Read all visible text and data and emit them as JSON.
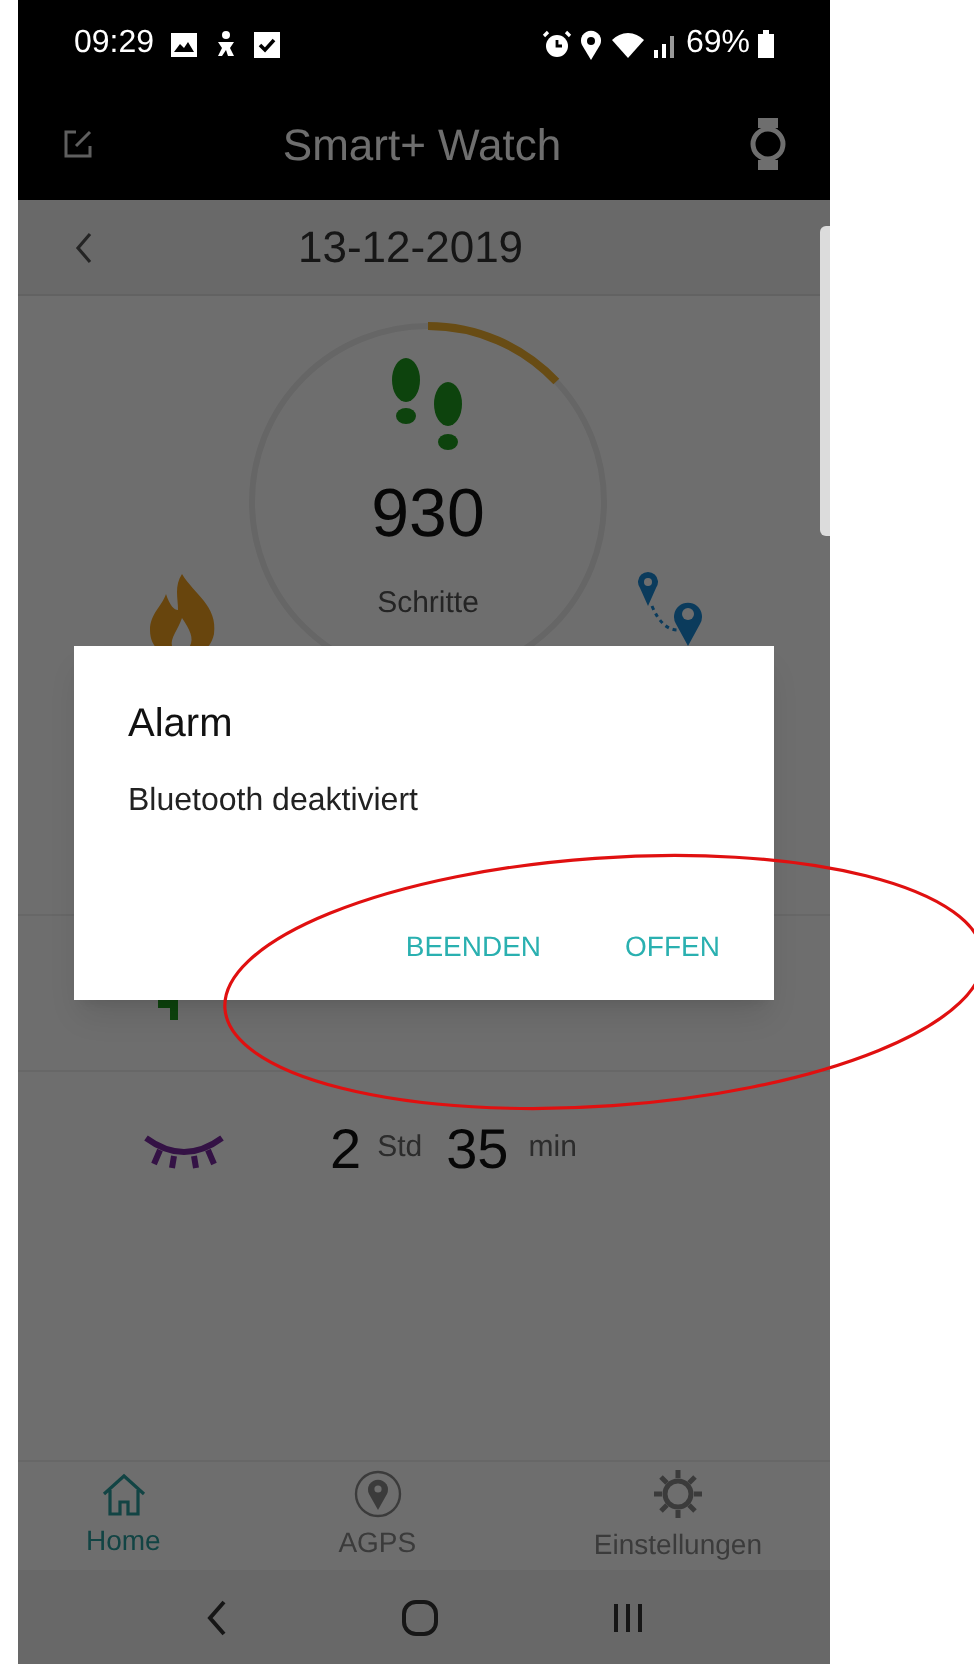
{
  "status_bar": {
    "time": "09:29",
    "battery": "69%"
  },
  "app_bar": {
    "title": "Smart+ Watch"
  },
  "date_bar": {
    "date": "13-12-2019"
  },
  "steps": {
    "value": "930",
    "label": "Schritte",
    "level": 0.13
  },
  "activity_rows": [
    {
      "kind": "walk"
    },
    {
      "kind": "sleep",
      "hours": "2",
      "hours_unit": "Std",
      "minutes": "35",
      "minutes_unit": "min"
    }
  ],
  "dialog": {
    "title": "Alarm",
    "message": "Bluetooth deaktiviert",
    "buttons": [
      "BEENDEN",
      "OFFEN"
    ]
  },
  "bottom_nav": [
    {
      "kind": "home",
      "label": "Home",
      "selected": true
    },
    {
      "kind": "agps",
      "label": "AGPS",
      "selected": false
    },
    {
      "kind": "settings",
      "label": "Einstellungen",
      "selected": false
    }
  ]
}
